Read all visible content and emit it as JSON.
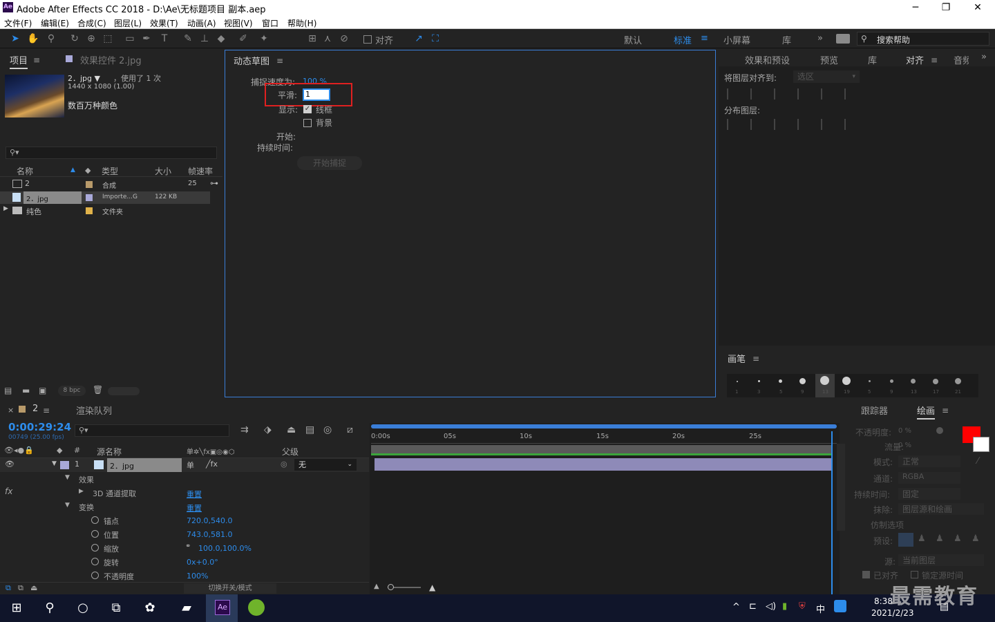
{
  "window": {
    "title": "Adobe After Effects CC 2018 - D:\\Ae\\无标题项目 副本.aep",
    "logo": "Ae",
    "minimize": "─",
    "maximize": "❐",
    "close": "✕"
  },
  "menu": [
    "文件(F)",
    "编辑(E)",
    "合成(C)",
    "图层(L)",
    "效果(T)",
    "动画(A)",
    "视图(V)",
    "窗口",
    "帮助(H)"
  ],
  "toolbar": {
    "align_label": "对齐",
    "workspaces": [
      "默认",
      "标准",
      "小屏幕",
      "库"
    ],
    "active_workspace": "标准",
    "more": "»",
    "search_placeholder": "搜索帮助"
  },
  "project_panel": {
    "tab_project": "项目",
    "tab_effects": "效果控件 2.jpg",
    "asset_name": "2．jpg ▼",
    "asset_used": "，使用了 1 次",
    "asset_dims": "1440 x 1080 (1.00)",
    "asset_colors": "数百万种颜色",
    "columns": [
      "名称",
      "类型",
      "大小",
      "帧速率"
    ],
    "items": [
      {
        "name": "2",
        "type": "合成",
        "size": "",
        "fps": "25",
        "color": "#b89a6a"
      },
      {
        "name": "2．jpg",
        "type": "Importe...G",
        "size": "122 KB",
        "fps": "",
        "color": "#a9a9d9"
      },
      {
        "name": "纯色",
        "type": "文件夹",
        "size": "",
        "fps": "",
        "color": "#e0b24a"
      }
    ],
    "bpc": "8 bpc"
  },
  "motion_sketch": {
    "title": "动态草图",
    "capture_speed_label": "捕捉速度为:",
    "capture_speed_value": "100 %",
    "smooth_label": "平滑:",
    "smooth_value": "1",
    "show_label": "显示:",
    "wireframe": "线框",
    "background": "背景",
    "start_label": "开始:",
    "duration_label": "持续时间:",
    "capture_button": "开始捕捉"
  },
  "right_panel": {
    "tabs": [
      "效果和预设",
      "预览",
      "库",
      "对齐",
      "音频"
    ],
    "active_tab": "对齐",
    "align_to_label": "将图层对齐到:",
    "align_to_value": "选区",
    "distribute_label": "分布图层:",
    "brush_title": "画笔",
    "brush_sizes": [
      "1",
      "3",
      "5",
      "9",
      "13",
      "19",
      "5",
      "9",
      "13",
      "17",
      "21"
    ]
  },
  "timeline": {
    "comp_tab": "2",
    "render_queue": "渲染队列",
    "timecode": "0:00:29:24",
    "frame_info": "00749 (25.00 fps)",
    "col_source": "源名称",
    "col_parent": "父级",
    "layer_num": "1",
    "layer_name": "2．jpg",
    "parent_value": "无",
    "effects_label": "效果",
    "channel_extract": "3D 通道提取",
    "reset": "重置",
    "transform": "变换",
    "props": [
      {
        "name": "锚点",
        "value": "720.0,540.0"
      },
      {
        "name": "位置",
        "value": "743.0,581.0"
      },
      {
        "name": "缩放",
        "value": "100.0,100.0%"
      },
      {
        "name": "旋转",
        "value": "0x+0.0°"
      },
      {
        "name": "不透明度",
        "value": "100%"
      }
    ],
    "ruler": [
      "0:00s",
      "05s",
      "10s",
      "15s",
      "20s",
      "25s"
    ],
    "toggle_label": "切换开关/模式"
  },
  "paint_panel": {
    "tab_tracker": "跟踪器",
    "tab_paint": "绘画",
    "opacity": "不透明度:",
    "opacity_value": "0 %",
    "flow": "流量:",
    "flow_value": "0 %",
    "mode": "模式:",
    "mode_value": "正常",
    "channels": "通道:",
    "channels_value": "RGBA",
    "duration": "持续时间:",
    "duration_value": "固定",
    "erase": "抹除:",
    "erase_value": "图层源和绘画",
    "clone_options": "仿制选项",
    "preset": "预设:",
    "source": "源:",
    "source_value": "当前图层",
    "aligned": "已对齐",
    "lock_time": "锁定源时间",
    "fg_color": "#ff0000",
    "bg_color": "#ffffff"
  },
  "taskbar": {
    "time": "8:38",
    "date": "2021/2/23",
    "ime": "中",
    "watermark": "最需教育"
  }
}
